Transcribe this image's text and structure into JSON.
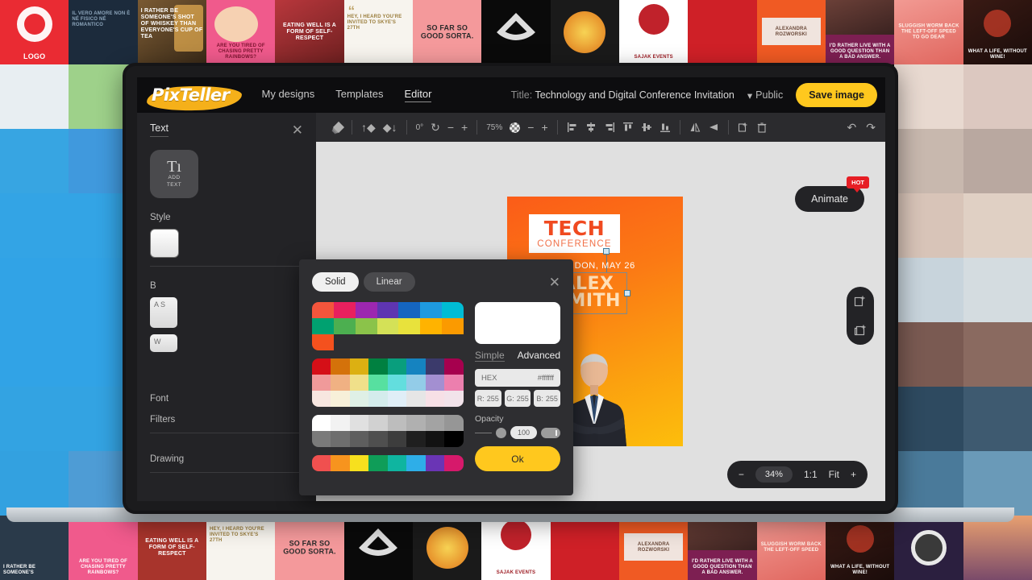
{
  "app": {
    "brand_pix": "Pix",
    "brand_teller": "Teller",
    "accent_yellow": "#ffc81e",
    "panel_bg": "#232326"
  },
  "topnav": {
    "links": [
      {
        "label": "My designs",
        "active": false
      },
      {
        "label": "Templates",
        "active": false
      },
      {
        "label": "Editor",
        "active": true
      }
    ],
    "title_prefix": "Title:",
    "title_value": "Technology and Digital Conference Invitation",
    "visibility": "Public",
    "visibility_caret": "▾",
    "save_label": "Save image"
  },
  "left_panel": {
    "title": "Text",
    "close": "✕",
    "add_text": {
      "glyph": "Tı",
      "line1": "ADD",
      "line2": "TEXT"
    },
    "sections": [
      {
        "label": "Style"
      },
      {
        "label": "B"
      },
      {
        "label": "Font"
      },
      {
        "label": "Filters"
      },
      {
        "label": "Drawing"
      }
    ],
    "field_align": "A\nS",
    "field_weight": "W"
  },
  "toolbar": {
    "layers_icon": "layers-icon",
    "bring_forward": "↑",
    "send_backward": "↓",
    "rotation_value": "0°",
    "rotation_reset": "↻",
    "rotation_minus": "−",
    "rotation_plus": "+",
    "opacity_value": "75%",
    "opacity_minus": "−",
    "opacity_plus": "+",
    "align_icons": [
      "align-left",
      "align-center-h",
      "align-right",
      "align-top",
      "align-middle-v",
      "align-bottom"
    ],
    "flip_h": "flip-horizontal",
    "flip_v": "flip-vertical",
    "duplicate": "duplicate-icon",
    "delete": "trash-icon",
    "undo": "↶",
    "redo": "↷"
  },
  "stage": {
    "animate_label": "Animate",
    "hot_badge": "HOT",
    "zoom": {
      "minus": "−",
      "level": "34%",
      "one_to_one": "1:1",
      "fit": "Fit",
      "plus": "+"
    },
    "right_tools": [
      "add-page-icon",
      "duplicate-page-icon"
    ]
  },
  "poster": {
    "tech_title": "TECH",
    "tech_sub": "CONFERENCE",
    "date_line": "LONDON, MAY 26",
    "name_first": "ALEX",
    "name_last": "SMITH",
    "bg_from": "#fb5c18",
    "bg_to": "#fdbe0c"
  },
  "color_dialog": {
    "tab_solid": "Solid",
    "tab_linear": "Linear",
    "close": "✕",
    "mode_simple": "Simple",
    "mode_advanced": "Advanced",
    "hex_label": "HEX",
    "hex_value": "#ffffff",
    "r_label": "R:",
    "r_value": "255",
    "g_label": "G:",
    "g_value": "255",
    "b_label": "B:",
    "b_value": "255",
    "opacity_label": "Opacity",
    "opacity_value": "100",
    "ok_label": "Ok",
    "preview_color": "#ffffff",
    "palettes": [
      {
        "cols": 7,
        "colors": [
          "#f4553c",
          "#e8205e",
          "#9c27b0",
          "#5e35b1",
          "#1565c0",
          "#1e9ae0",
          "#00bcd4",
          "#00a170",
          "#4caf50",
          "#8bc34a",
          "#d4e157",
          "#e8e23c",
          "#ffb300",
          "#fb9a00"
        ],
        "extra": [
          "#f4511e"
        ]
      },
      {
        "cols": 8,
        "colors": [
          "#d50f17",
          "#d4720a",
          "#dcb012",
          "#008040",
          "#099e7d",
          "#1583c0",
          "#3b3a6b",
          "#a6004e",
          "#f09a9a",
          "#f0b183",
          "#f0e08a",
          "#57e0a0",
          "#63dede",
          "#93cce8",
          "#a38fd1",
          "#ec7fae",
          "#f7e6e0",
          "#f7f0d9",
          "#dff0e6",
          "#d4ecec",
          "#e0eef7",
          "#e6e6e6",
          "#f7e0e6",
          "#f2e3ea"
        ]
      },
      {
        "cols": 8,
        "colors": [
          "#ffffff",
          "#f2f2f2",
          "#e0e0e0",
          "#d1d1d1",
          "#bdbdbd",
          "#b0b0b0",
          "#a3a3a3",
          "#969696",
          "#7a7a7a",
          "#6e6e6e",
          "#5e5e5e",
          "#4f4f4f",
          "#3d3d3d",
          "#1f1f1f",
          "#121212",
          "#000000"
        ]
      },
      {
        "cols": 8,
        "colors": [
          "#f0504f",
          "#f7941e",
          "#f7e01e",
          "#0f9d58",
          "#0fb5a0",
          "#2eaee8",
          "#6a35b5",
          "#d6196b"
        ]
      }
    ]
  },
  "collage": {
    "row1": [
      {
        "bg": "#ea2b33",
        "label": "LOGO",
        "style": "logo",
        "size": "big"
      },
      {
        "bg": "#1c2b3c",
        "label": "IL VERO AMORE NON È NÉ FISICO NÉ ROMANTICO",
        "size": "small",
        "pos": "top"
      },
      {
        "bg": "#6b4a2a",
        "label": "I RATHER BE SOMEONE'S SHOT OF WHISKEY THAN EVERYONE'S CUP OF TEA",
        "size": "mid",
        "pos": "top"
      },
      {
        "bg": "#f05a8c",
        "label": "Are you tired of chasing pretty rainbows?",
        "size": "small",
        "pos": "bottom"
      },
      {
        "bg": "#c0392b",
        "label": "EATING WELL IS A FORM OF SELF-RESPECT",
        "size": "mid",
        "pos": "mid"
      },
      {
        "bg": "#f5f2ec",
        "label": "HEY, I HEARD YOU'RE INVITED TO SKYE'S 27TH",
        "size": "small",
        "pos": "top",
        "dark": true
      },
      {
        "bg": "#f4999b",
        "label": "SO FAR SO GOOD SORTA.",
        "size": "big",
        "pos": "mid",
        "dark": true
      },
      {
        "bg": "#0a0a0a",
        "label": "",
        "size": "small"
      },
      {
        "bg": "#e8951c",
        "label": "",
        "size": "small"
      },
      {
        "bg": "#ffffff",
        "label": "SAJAK EVENTS",
        "size": "small",
        "pos": "bottom",
        "dark": true
      },
      {
        "bg": "#cf2027",
        "label": "",
        "size": "small"
      },
      {
        "bg": "#f05a23",
        "label": "ALEXANDRA ROZWORSKI",
        "size": "small",
        "pos": "mid"
      },
      {
        "bg": "#7d1f52",
        "label": "I'D RATHER LIVE WITH A GOOD QUESTION THAN A BAD ANSWER.",
        "size": "small",
        "pos": "bottom"
      },
      {
        "bg": "#e8736c",
        "label": "Sluggish worm back the left-off speed to go Dear",
        "size": "small",
        "pos": "mid"
      },
      {
        "bg": "#2a1c1c",
        "label": "WHAT A LIFE, WITHOUT WINE!",
        "size": "small",
        "pos": "bottom"
      }
    ]
  }
}
